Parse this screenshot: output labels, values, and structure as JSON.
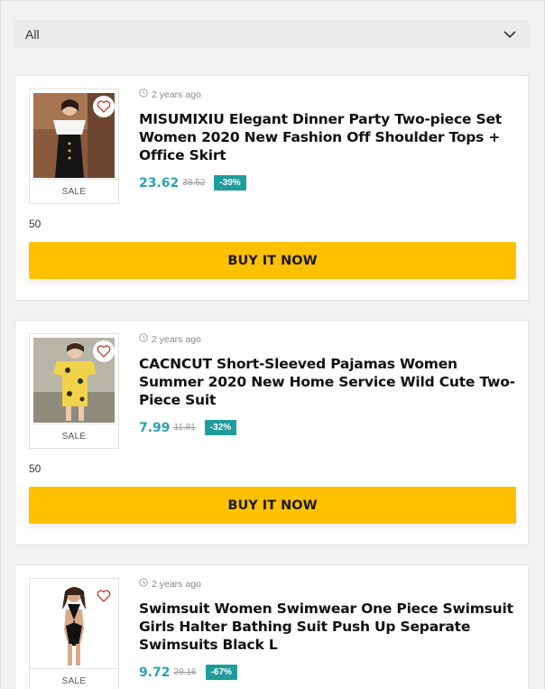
{
  "filter": {
    "selected": "All"
  },
  "products": [
    {
      "time_ago": "2 years ago",
      "title": "MISUMIXIU Elegant Dinner Party Two-piece Set Women 2020 New Fashion Off Shoulder Tops + Office Skirt",
      "price": "23.62",
      "old_price": "38.52",
      "discount": "-39%",
      "sale_label": "SALE",
      "count": "50",
      "button_label": "BUY IT NOW"
    },
    {
      "time_ago": "2 years ago",
      "title": "CACNCUT Short-Sleeved Pajamas Women Summer 2020 New Home Service Wild Cute Two-Piece Suit",
      "price": "7.99",
      "old_price": "11.81",
      "discount": "-32%",
      "sale_label": "SALE",
      "count": "50",
      "button_label": "BUY IT NOW"
    },
    {
      "time_ago": "2 years ago",
      "title": "Swimsuit Women Swimwear One Piece Swimsuit Girls Halter Bathing Suit Push Up Separate Swimsuits Black L",
      "price": "9.72",
      "old_price": "29.16",
      "discount": "-67%",
      "sale_label": "SALE"
    }
  ],
  "colors": {
    "accent_price": "#2aa1b3",
    "discount_bg": "#1f9c9c",
    "buy_button": "#ffc000",
    "heart": "#c0392b"
  },
  "icons": {
    "filter": "chevron-down-icon",
    "time": "clock-icon",
    "wishlist": "heart-icon"
  }
}
